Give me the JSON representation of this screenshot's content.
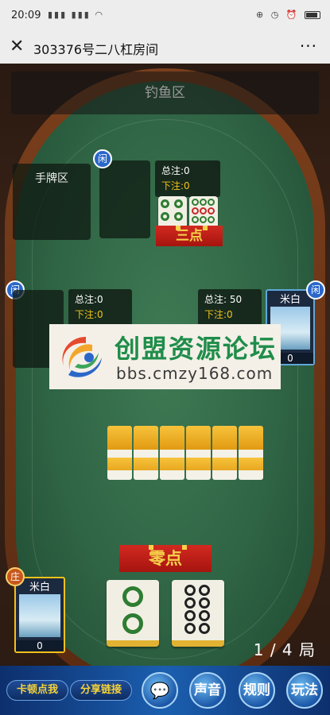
{
  "status": {
    "time": "20:09",
    "signal": "4G",
    "right_icons": "⊕ ◷ ⏰"
  },
  "titlebar": {
    "title": "303376号二八杠房间"
  },
  "zones": {
    "fish": "钓鱼区",
    "hand": "手牌区"
  },
  "badges": {
    "idle": "闲",
    "dealer": "庄"
  },
  "bets": {
    "top": {
      "total": "总注:0",
      "bet": "下注:0"
    },
    "left": {
      "total": "总注:0",
      "bet": "下注:0"
    },
    "right": {
      "total": "总注: 50",
      "bet": "下注:0"
    }
  },
  "results": {
    "top": "三点",
    "bottom": "零点"
  },
  "players": {
    "right": {
      "name": "米白",
      "score": "0"
    },
    "bottom": {
      "name": "米白",
      "score": "0"
    }
  },
  "watermark": {
    "title": "创盟资源论坛",
    "url": "bbs.cmzy168.com"
  },
  "round": "1 / 4 局",
  "bottombar": {
    "lag": "卡顿点我",
    "share": "分享链接",
    "chat": "💬",
    "sound": "声音",
    "rules": "规则",
    "play": "玩法"
  },
  "colors": {
    "felt": "#2f6444",
    "rim": "#6b3318",
    "gold": "#f2c21b",
    "idle_badge": "#2b67c9",
    "dealer_badge": "#c8571c"
  }
}
